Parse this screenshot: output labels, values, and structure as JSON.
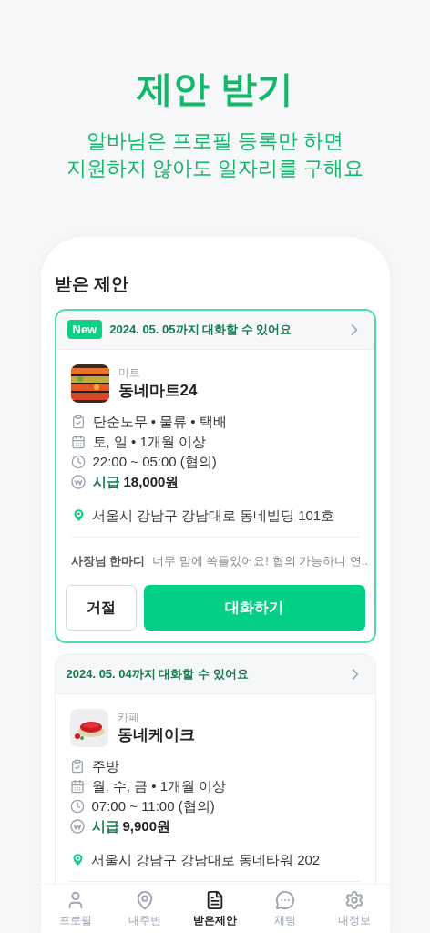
{
  "header": {
    "title": "제안 받기",
    "subtitle_lines": [
      "알바님은 프로필 등록만 하면",
      "지원하지 않아도 일자리를 구해요"
    ]
  },
  "section_title": "받은 제안",
  "offers": [
    {
      "highlighted": true,
      "badge": "New",
      "deadline": "2024. 05. 05까지 대화할 수 있어요",
      "category": "마트",
      "name": "동네마트24",
      "details": [
        {
          "kind": "task",
          "text": "단순노무 • 물류 • 택배"
        },
        {
          "kind": "schedule",
          "text": "토, 일 • 1개월 이상"
        },
        {
          "kind": "time",
          "text": "22:00 ~ 05:00 (협의)"
        },
        {
          "kind": "pay",
          "label": "시급",
          "text": "18,000원"
        }
      ],
      "address": "서울시 강남구 강남대로 동네빌딩 101호",
      "memo": {
        "label": "사장님 한마디",
        "text": "너무 맘에 쏙들었어요! 협의 가능하니 연.."
      },
      "actions": [
        {
          "kind": "secondary",
          "label": "거절"
        },
        {
          "kind": "primary",
          "label": "대화하기"
        }
      ]
    },
    {
      "highlighted": false,
      "deadline": "2024. 05. 04까지 대화할 수 있어요",
      "category": "카페",
      "name": "동네케이크",
      "details": [
        {
          "kind": "task",
          "text": "주방"
        },
        {
          "kind": "schedule",
          "text": "월, 수, 금 • 1개월 이상"
        },
        {
          "kind": "time",
          "text": "07:00 ~ 11:00 (협의)"
        },
        {
          "kind": "pay",
          "label": "시급",
          "text": "9,900원"
        }
      ],
      "address": "서울시 강남구 강남대로 동네타워 202"
    }
  ],
  "nav": [
    {
      "kind": "profile",
      "label": "프로필",
      "selected": false
    },
    {
      "kind": "nearby",
      "label": "내주변",
      "selected": false
    },
    {
      "kind": "offers",
      "label": "받은제안",
      "selected": true
    },
    {
      "kind": "chat",
      "label": "채팅",
      "selected": false
    },
    {
      "kind": "settings",
      "label": "내정보",
      "selected": false
    }
  ]
}
